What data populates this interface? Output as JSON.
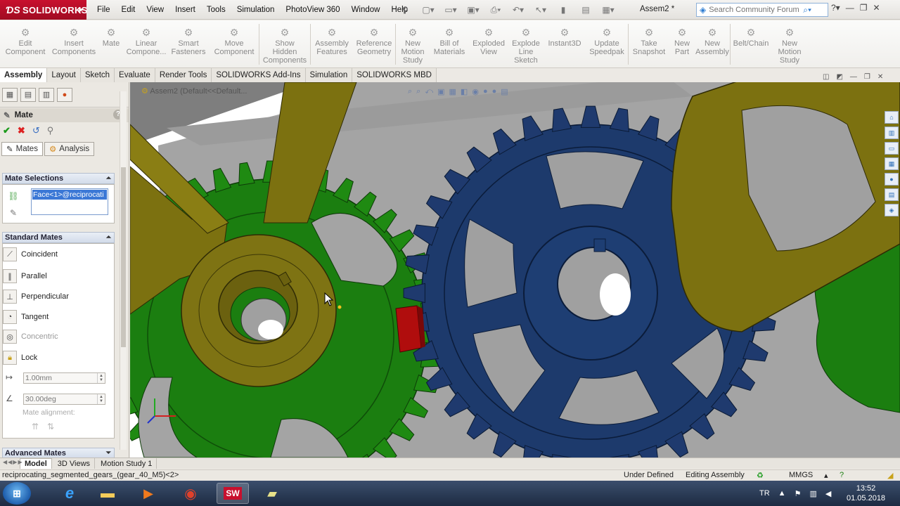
{
  "app": {
    "brand": "SOLIDWORKS",
    "document_title": "Assem2 *"
  },
  "menu": [
    "File",
    "Edit",
    "View",
    "Insert",
    "Tools",
    "Simulation",
    "PhotoView 360",
    "Window",
    "Help"
  ],
  "search": {
    "placeholder": "Search Community Forum"
  },
  "command_manager": [
    {
      "label": "Edit\nComponent",
      "icon": "edit-component-icon"
    },
    {
      "label": "Insert\nComponents",
      "icon": "insert-components-icon"
    },
    {
      "label": "Mate",
      "icon": "mate-icon"
    },
    {
      "label": "Linear\nCompone...",
      "icon": "linear-pattern-icon"
    },
    {
      "label": "Smart\nFasteners",
      "icon": "smart-fasteners-icon"
    },
    {
      "label": "Move\nComponent",
      "icon": "move-component-icon"
    },
    {
      "label": "Show\nHidden\nComponents",
      "icon": "show-hidden-icon"
    },
    {
      "label": "Assembly\nFeatures",
      "icon": "assembly-features-icon"
    },
    {
      "label": "Reference\nGeometry",
      "icon": "reference-geometry-icon"
    },
    {
      "label": "New\nMotion\nStudy",
      "icon": "motion-study-icon"
    },
    {
      "label": "Bill of\nMaterials",
      "icon": "bom-icon"
    },
    {
      "label": "Exploded\nView",
      "icon": "exploded-view-icon"
    },
    {
      "label": "Explode\nLine\nSketch",
      "icon": "explode-line-icon"
    },
    {
      "label": "Instant3D",
      "icon": "instant3d-icon"
    },
    {
      "label": "Update\nSpeedpak",
      "icon": "speedpak-icon"
    },
    {
      "label": "Take\nSnapshot",
      "icon": "snapshot-icon"
    },
    {
      "label": "New\nPart",
      "icon": "new-part-icon"
    },
    {
      "label": "New\nAssembly",
      "icon": "new-assembly-icon"
    },
    {
      "label": "Belt/Chain",
      "icon": "belt-chain-icon"
    },
    {
      "label": "New\nMotion\nStudy",
      "icon": "motion-study-icon"
    }
  ],
  "command_tabs": [
    "Assembly",
    "Layout",
    "Sketch",
    "Evaluate",
    "Render Tools",
    "SOLIDWORKS Add-Ins",
    "Simulation",
    "SOLIDWORKS MBD"
  ],
  "property_manager": {
    "title": "Mate",
    "tabs": [
      "Mates",
      "Analysis"
    ],
    "mate_selections": {
      "header": "Mate Selections",
      "selected": "Face<1>@reciprocati"
    },
    "standard_mates": {
      "header": "Standard Mates",
      "items": [
        "Coincident",
        "Parallel",
        "Perpendicular",
        "Tangent",
        "Concentric",
        "Lock"
      ],
      "distance": "1.00mm",
      "angle": "30.00deg",
      "alignment_label": "Mate alignment:"
    },
    "advanced_header": "Advanced Mates"
  },
  "viewport": {
    "tree_flyout": "Assem2 (Default<<Default..."
  },
  "model_tabs": [
    "Model",
    "3D Views",
    "Motion Study 1"
  ],
  "status": {
    "selection": "reciprocating_segmented_gears_(gear_40_M5)<2>",
    "definition": "Under Defined",
    "mode": "Editing Assembly",
    "units": "MMGS"
  },
  "taskbar": {
    "language": "TR",
    "time": "13:52",
    "date": "01.05.2018"
  },
  "colors": {
    "gear_green": "#1f8a12",
    "gear_blue": "#1f3a6e",
    "arm_olive": "#7f7312",
    "brand_red": "#c8102e"
  }
}
